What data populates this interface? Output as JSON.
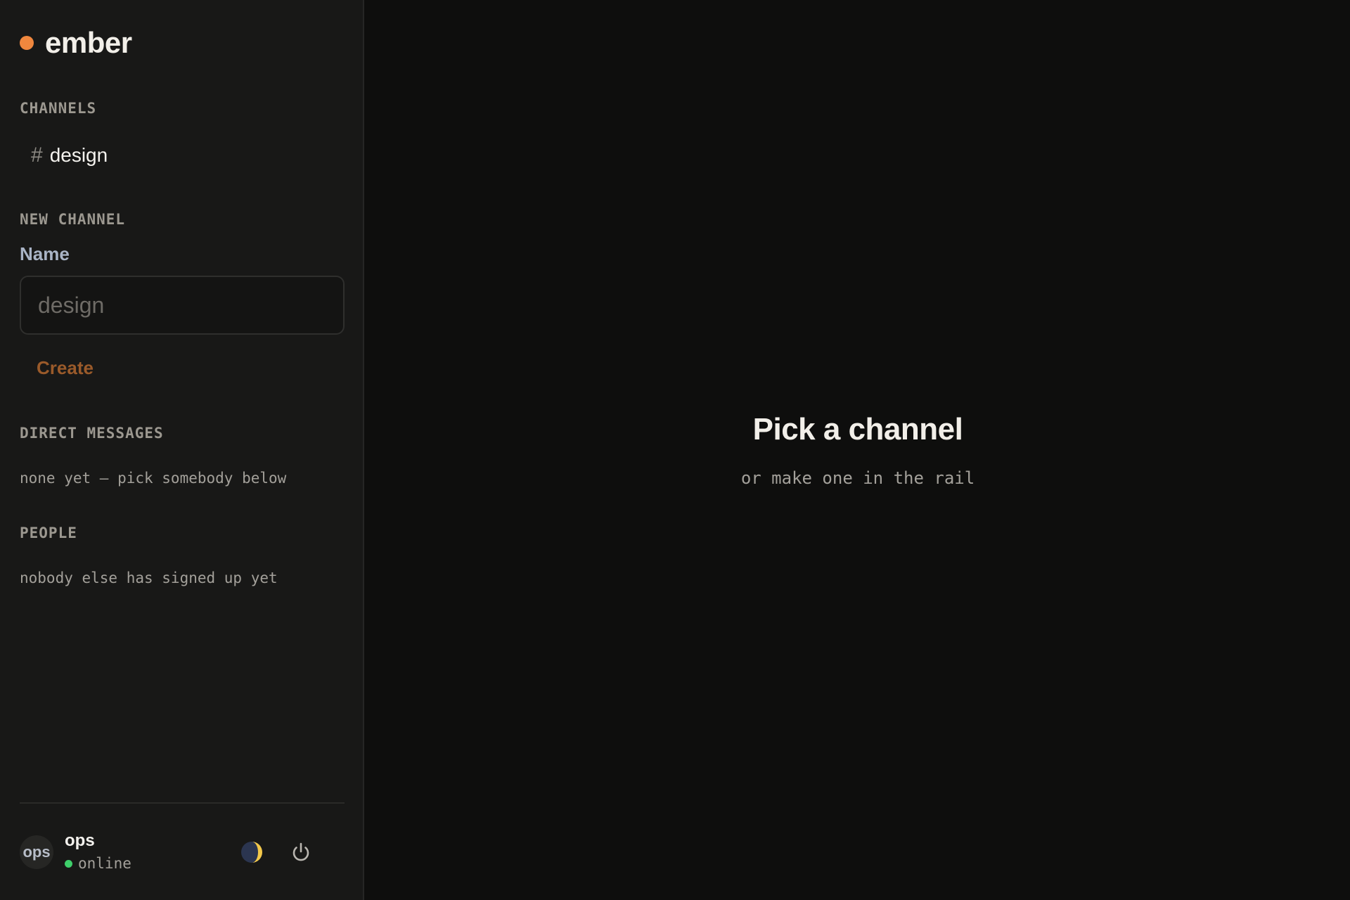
{
  "brand": {
    "name": "ember",
    "accent_color": "#f0873e"
  },
  "sidebar": {
    "channels_label": "CHANNELS",
    "channels": [
      {
        "hash": "#",
        "name": "design"
      }
    ],
    "new_channel": {
      "section_label": "NEW CHANNEL",
      "field_label": "Name",
      "input_value": "",
      "input_placeholder": "design",
      "create_label": "Create"
    },
    "direct_messages": {
      "label": "DIRECT MESSAGES",
      "empty_text": "none yet — pick somebody below"
    },
    "people": {
      "label": "PEOPLE",
      "empty_text": "nobody else has signed up yet"
    },
    "user": {
      "avatar_text": "ops",
      "name": "ops",
      "status": "online",
      "status_color": "#3ecf6a",
      "theme_toggle_icon": "moon-sun-icon",
      "logout_icon": "power-icon"
    }
  },
  "main": {
    "empty_title": "Pick a channel",
    "empty_subtitle": "or make one in the rail"
  }
}
